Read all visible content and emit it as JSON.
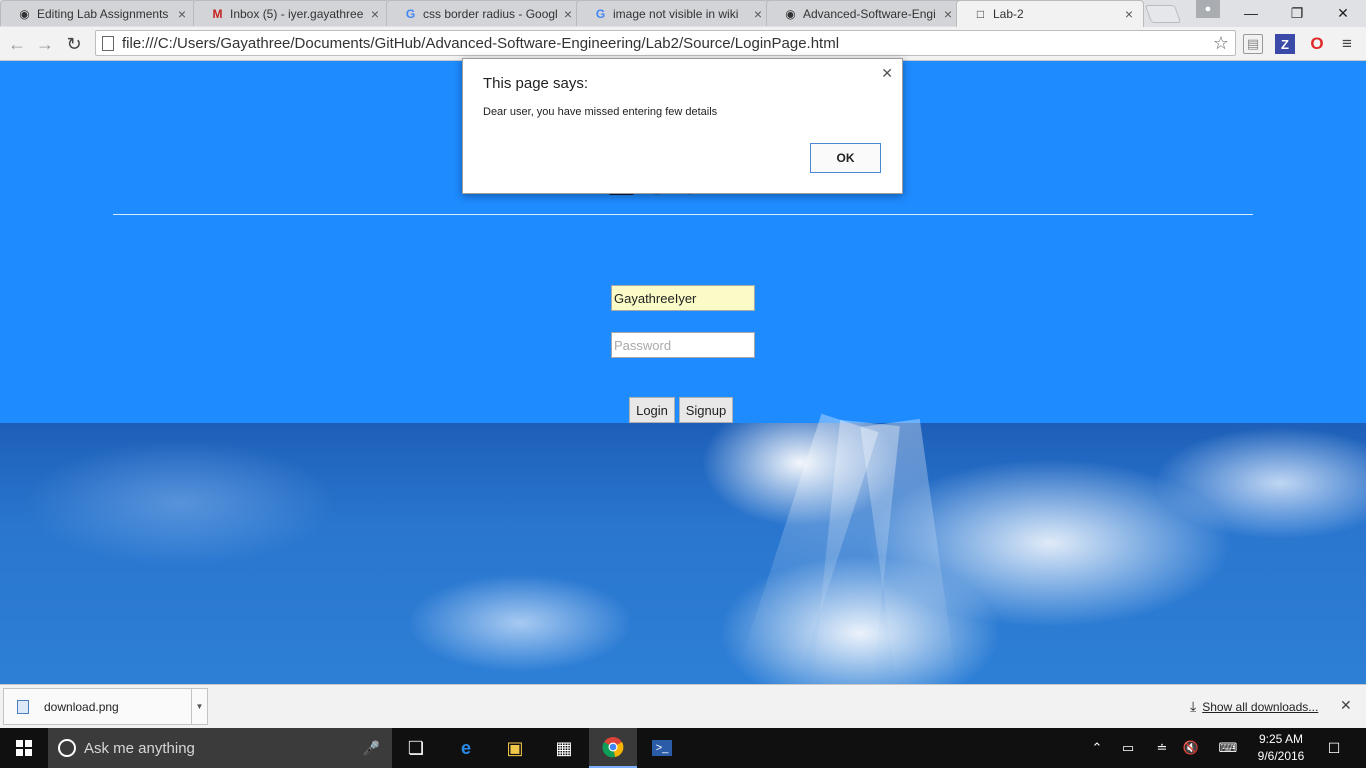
{
  "browser": {
    "tabs": [
      {
        "title": "Editing Lab Assignments",
        "icon": "github-icon",
        "active": false
      },
      {
        "title": "Inbox (5) - iyer.gayathree",
        "icon": "gmail-icon",
        "active": false
      },
      {
        "title": "css border radius - Googl",
        "icon": "google-icon",
        "active": false
      },
      {
        "title": "image not visible in wiki",
        "icon": "google-icon",
        "active": false
      },
      {
        "title": "Advanced-Software-Engi",
        "icon": "github-icon",
        "active": false
      },
      {
        "title": "Lab-2",
        "icon": "page-icon",
        "active": true
      }
    ],
    "url": "file:///C:/Users/Gayathree/Documents/GitHub/Advanced-Software-Engineering/Lab2/Source/LoginPage.html",
    "extensions": [
      "shield-extension-icon",
      "zotero-extension-icon",
      "opera-extension-icon"
    ]
  },
  "page": {
    "heading": "SIGN IN",
    "username_value": "GayathreeIyer",
    "username_placeholder": "",
    "password_placeholder": "Password",
    "login_label": "Login",
    "signup_label": "Signup"
  },
  "dialog": {
    "title": "This page says:",
    "message": "Dear user, you have missed entering few details",
    "ok_label": "OK"
  },
  "downloads": {
    "file_name": "download.png",
    "show_all_label": "Show all downloads..."
  },
  "taskbar": {
    "search_placeholder": "Ask me anything",
    "time": "9:25 AM",
    "date": "9/6/2016"
  },
  "colors": {
    "page_background": "#1e8bff",
    "autofill_background": "#fafbc6"
  }
}
